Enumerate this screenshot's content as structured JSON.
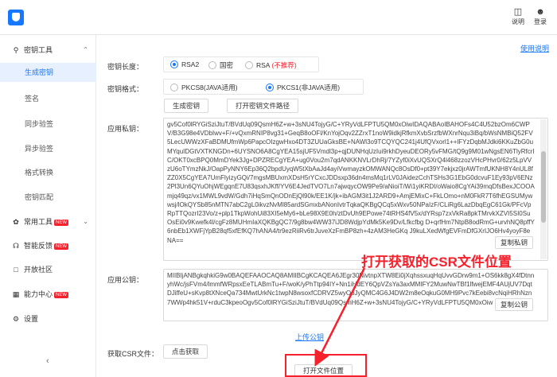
{
  "topbar": {
    "manual_label": "说明",
    "login_label": "登录"
  },
  "sidebar": {
    "group_key_tools": "密钥工具",
    "sub_items": [
      "生成密钥",
      "签名",
      "同步验签",
      "异步验签",
      "格式转换",
      "密钥匹配"
    ],
    "common_tools": "常用工具",
    "smart_feedback": "智能反馈",
    "open_community": "开放社区",
    "ability_center": "能力中心",
    "settings": "设置",
    "new_badge": "NEW",
    "collapse_icon": "chevron-left"
  },
  "main": {
    "help_link": "使用说明",
    "key_length_label": "密钥长度：",
    "key_length_options": [
      "RSA2",
      "国密",
      "RSA"
    ],
    "rsa_note": "(不推荐)",
    "key_format_label": "密钥格式：",
    "key_format_options": [
      "PKCS8(JAVA适用)",
      "PKCS1(非JAVA适用)"
    ],
    "generate_button": "生成密钥",
    "open_path_button": "打开密钥文件路径",
    "private_key_label": "应用私钥：",
    "private_key_value": "gv5Cof0lRYGiSziJtuT/BVdUq09QsmH6Z+w+3sNU4TojyG/C+YRyVdLFPTU5QM0xOiwIDAQABAoIBAHOFs4C4U52bzOm6CWPV/B3G98e4VDbIwv+F/+vQxmRNIP8vg31+GeqB8oOFl/KnYojOqv2ZZrxT1noW9idkjRfkmXvbSrzfbWXnrNqu3iBq/bWsNMBiQ52FV5LecUWWzXFaBDMUfmWp6PapcOIzgwHxo4DT3ZUUaGksBE+NAWl3o9TCQYQC241j4UfQVxorl1++lFYzDqbMJdki6KKuZbG0uMYquIDGtVXTKNGDn+6UYSNO6A8CgYEA15sjUF5Vmdl3p+qjDUNHqUzIui9rkhDyeuDEORy5vFMG/tQ9g9M01wNgsEN6TlyRfcrIC/OKT0xcBPQ0MmDYek3Jg+DPZRECgYEA+ug0Vou2m7qdANKKNVLrDhRj/7YZyf0iXvUQSXrQ4l468zzozVHcPHvr0/62z5LpVVzU6oTYmzNkJ/OapPyNNY6Ep36Q2bpdUyqW5tXbAaJd4ayiVwmayzkOMWANQc8OsDf0+pt39Y7ekjxz0jrAWTmfUKNH8Y4nUL8fZZ0X5CgYEA7UmFlyizyGQi/7mgsMBUxmXDsH5rYCxcJDDsxp36dn4msMq1rLV0JAidezCchTSHs3G1EbG0dcvuF1Ey93pV6ENz2Pl3Un6QYuOhjWEgqnE7U83qsxhJKff/YV6E4JedTVO7Ln7ajwqycOW9Pe9/aNioiT/Wi1yiKRDI/oWaio8CgYAi39mqDfsBexJCOOAmjq49qz/vx1MWL9vdW/Gdh7iHqSmQnODnEjQl90k/EE1K/jk+ibAGM3it1J2ARD9+AmjEMixC+FkLOmo+nM0FkR7T6fhEGSUMywwsj/lOkQYSb85nMTN7abC2gL0ikvzNvMl85ardSGmxbANonIvtrTqkaQKBgQCq5xWxv50NPaIzF/CLiRg6LazDbqEgC61Gk/PFcVpRpTTQozrI23Vo/z+plp1TkpWohUi83XI5eMy6+bLe98X9E0h/ztDvUh9EPowe74tRHS4fV5x/dYRsp7zxVkRa8pkTMrvkXZVI5SI0SuOsEi0v9Kwefk4l/cgFz8MUHmIaXQKBgQC7/9g8bw4WW37iJD8WdjpYdMk5Ke9Dv/Lfkcfbg D+qrfHm7NtpB8odRmG+urvhNQ8pffY6nbEb1XWFjYpB28qf5xfEfKQ7hANA4/tr9ezRiiRv6trJuveXzFmBP8zh+4zAM3HeGKq J9kuLXedWfgEVFmDfGXrIJO6Hv4yoyF8eNA==",
    "copy_private_button": "复制私钥",
    "public_key_label": "应用公钥：",
    "public_key_value": "MIIBIjANBgkqhkiG9w0BAQEFAAOCAQ8AMIIBCgKCAQEA6JEgr30NivtnpXTW8Ei0jXqhssxuqHqUvvGDrw9m1+OS6kk8gX4fDtnnyhWc/jsFVm4/lmmfWRpsxEeTLABmTu+F/woK/yPhTtp94IY+Nn1iHdEY6QpVZsYa3axMMIFY2MuwNwTBf1lfwejEMF4AUjUV7DqtDJiffeU+sKvp8tXNceQa734MwtUrkNc1twpN8wsoxfCDRVZ5wyOoJyQMC4G6J4DW2m8eOqkuG0MH9Pvc7kEebi8vcNqiHRhNzn7WWp4hk51V+rduC3kpeoOgv5Cof0lRYGiSziJtuT/BVdUq09QsmH6Z+w+3sNU4TojyG/C+YRyVdLFPTU5QM0xOiw",
    "copy_public_button": "复制公钥",
    "upload_link": "上传公钥",
    "csr_label": "获取CSR文件：",
    "get_csr_button": "点击获取",
    "open_csr_button": "打开文件位置",
    "annotation_text": "打开获取的CSR文件位置"
  },
  "colors": {
    "accent": "#1677ff",
    "highlight_red": "#f5222d"
  }
}
